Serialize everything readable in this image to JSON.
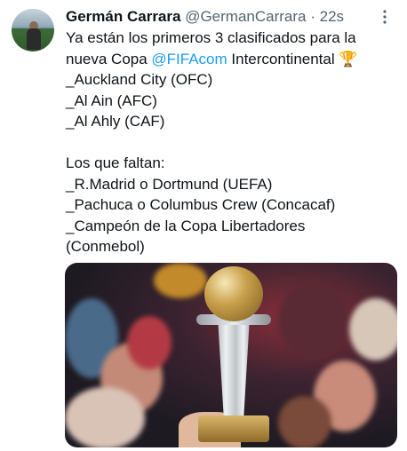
{
  "author": {
    "name": "Germán Carrara",
    "handle": "@GermanCarrara",
    "separator": "·",
    "time": "22s"
  },
  "more_icon": "more-dots-icon",
  "tweet": {
    "line1": "Ya están los primeros 3 clasificados para la",
    "line2_prefix": "nueva Copa ",
    "mention": "@FIFAcom",
    "line2_suffix": " Intercontinental ",
    "emoji": "🏆",
    "body": "_Auckland City (OFC)\n_Al Ain (AFC)\n_Al Ahly (CAF)\n\nLos que faltan:\n_R.Madrid o Dortmund (UEFA)\n_Pachuca o Columbus Crew (Concacaf)\n_Campeón de la Copa Libertadores\n(Conmebol)"
  },
  "colors": {
    "mention": "#1d9bf0",
    "secondary_text": "#536471",
    "primary_text": "#0f1419"
  }
}
